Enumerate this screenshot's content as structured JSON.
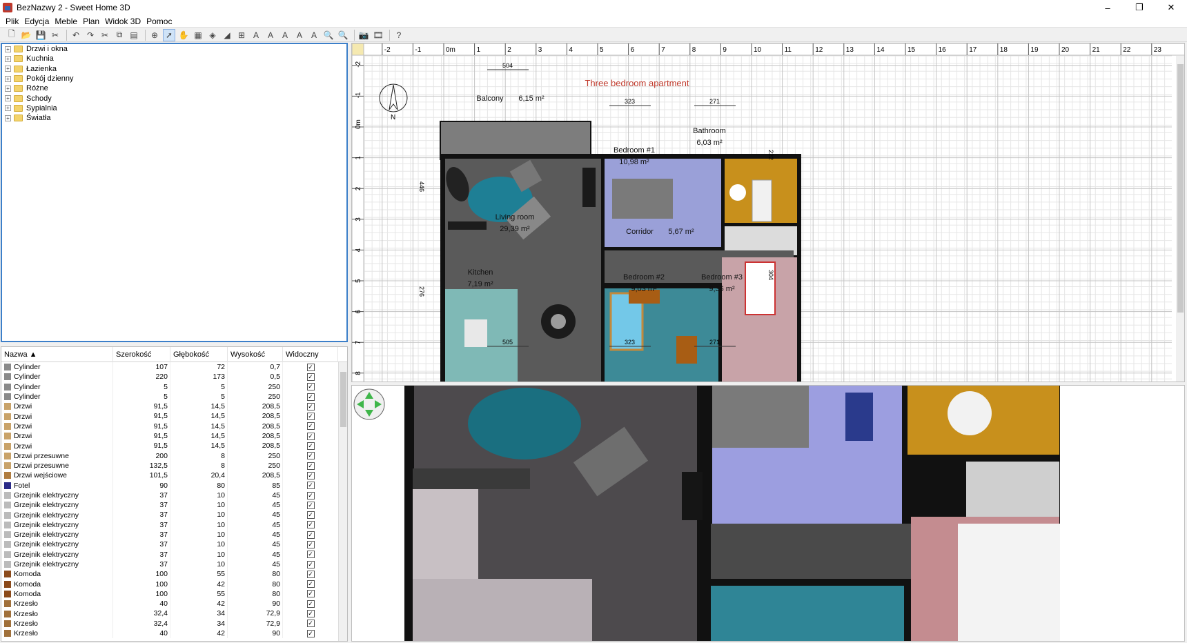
{
  "window": {
    "title": "BezNazwy 2 - Sweet Home 3D",
    "min": "–",
    "max": "❐",
    "close": "✕"
  },
  "menu": [
    "Plik",
    "Edycja",
    "Meble",
    "Plan",
    "Widok 3D",
    "Pomoc"
  ],
  "catalog": {
    "categories": [
      "Drzwi i okna",
      "Kuchnia",
      "Łazienka",
      "Pokój dzienny",
      "Różne",
      "Schody",
      "Sypialnia",
      "Światła"
    ]
  },
  "furniture_table": {
    "columns": [
      "Nazwa ▲",
      "Szerokość",
      "Głębokość",
      "Wysokość",
      "Widoczny"
    ],
    "rows": [
      {
        "name": "Cylinder",
        "w": "107",
        "d": "72",
        "h": "0,7"
      },
      {
        "name": "Cylinder",
        "w": "220",
        "d": "173",
        "h": "0,5"
      },
      {
        "name": "Cylinder",
        "w": "5",
        "d": "5",
        "h": "250"
      },
      {
        "name": "Cylinder",
        "w": "5",
        "d": "5",
        "h": "250"
      },
      {
        "name": "Drzwi",
        "w": "91,5",
        "d": "14,5",
        "h": "208,5"
      },
      {
        "name": "Drzwi",
        "w": "91,5",
        "d": "14,5",
        "h": "208,5"
      },
      {
        "name": "Drzwi",
        "w": "91,5",
        "d": "14,5",
        "h": "208,5"
      },
      {
        "name": "Drzwi",
        "w": "91,5",
        "d": "14,5",
        "h": "208,5"
      },
      {
        "name": "Drzwi",
        "w": "91,5",
        "d": "14,5",
        "h": "208,5"
      },
      {
        "name": "Drzwi przesuwne",
        "w": "200",
        "d": "8",
        "h": "250"
      },
      {
        "name": "Drzwi przesuwne",
        "w": "132,5",
        "d": "8",
        "h": "250"
      },
      {
        "name": "Drzwi wejściowe",
        "w": "101,5",
        "d": "20,4",
        "h": "208,5"
      },
      {
        "name": "Fotel",
        "w": "90",
        "d": "80",
        "h": "85"
      },
      {
        "name": "Grzejnik elektryczny",
        "w": "37",
        "d": "10",
        "h": "45"
      },
      {
        "name": "Grzejnik elektryczny",
        "w": "37",
        "d": "10",
        "h": "45"
      },
      {
        "name": "Grzejnik elektryczny",
        "w": "37",
        "d": "10",
        "h": "45"
      },
      {
        "name": "Grzejnik elektryczny",
        "w": "37",
        "d": "10",
        "h": "45"
      },
      {
        "name": "Grzejnik elektryczny",
        "w": "37",
        "d": "10",
        "h": "45"
      },
      {
        "name": "Grzejnik elektryczny",
        "w": "37",
        "d": "10",
        "h": "45"
      },
      {
        "name": "Grzejnik elektryczny",
        "w": "37",
        "d": "10",
        "h": "45"
      },
      {
        "name": "Grzejnik elektryczny",
        "w": "37",
        "d": "10",
        "h": "45"
      },
      {
        "name": "Komoda",
        "w": "100",
        "d": "55",
        "h": "80"
      },
      {
        "name": "Komoda",
        "w": "100",
        "d": "42",
        "h": "80"
      },
      {
        "name": "Komoda",
        "w": "100",
        "d": "55",
        "h": "80"
      },
      {
        "name": "Krzesło",
        "w": "40",
        "d": "42",
        "h": "90"
      },
      {
        "name": "Krzesło",
        "w": "32,4",
        "d": "34",
        "h": "72,9"
      },
      {
        "name": "Krzesło",
        "w": "32,4",
        "d": "34",
        "h": "72,9"
      },
      {
        "name": "Krzesło",
        "w": "40",
        "d": "42",
        "h": "90"
      }
    ]
  },
  "plan": {
    "ruler_x": [
      "-2",
      "-1",
      "0m",
      "1",
      "2",
      "3",
      "4",
      "5",
      "6",
      "7",
      "8",
      "9",
      "10",
      "11",
      "12",
      "13",
      "14",
      "15",
      "16",
      "17",
      "18",
      "19",
      "20",
      "21",
      "22",
      "23"
    ],
    "ruler_y": [
      "-2",
      "-1",
      "0m",
      "1",
      "2",
      "3",
      "4",
      "5",
      "6",
      "7",
      "8"
    ],
    "label": "Three bedroom apartment",
    "dims": {
      "top1": "504",
      "top2": "323",
      "top3": "271",
      "bottom1": "505",
      "bottom2": "323",
      "bottom3": "271",
      "left1": "446",
      "left2": "276",
      "right1": "222",
      "right2": "304"
    },
    "compass": "N",
    "rooms": [
      {
        "name": "Balcony",
        "area": "6,15 m²"
      },
      {
        "name": "Living room",
        "area": "29,39 m²"
      },
      {
        "name": "Bedroom #1",
        "area": "10,98 m²"
      },
      {
        "name": "Bathroom",
        "area": "6,03 m²"
      },
      {
        "name": "Corridor",
        "area": "5,67 m²"
      },
      {
        "name": "Kitchen",
        "area": "7,19 m²"
      },
      {
        "name": "Bedroom #2",
        "area": "9,03 m²"
      },
      {
        "name": "Bedroom #3",
        "area": "9,36 m²"
      }
    ],
    "colors": {
      "wall": "#111111",
      "living": "#5a5a5a",
      "bedroom1": "#9aa0d8",
      "bathroom": "#c8901c",
      "kitchen": "#7fb9b6",
      "bedroom2": "#3d8a97",
      "bedroom3": "#c8a3a8",
      "label": "#c0392b"
    }
  }
}
